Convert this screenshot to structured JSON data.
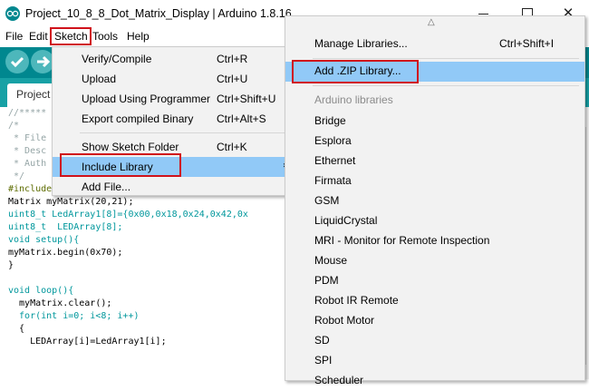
{
  "window": {
    "title": "Project_10_8_8_Dot_Matrix_Display | Arduino 1.8.16",
    "minimize_glyph": "",
    "maximize_glyph": "",
    "close_glyph": "✕"
  },
  "menubar": {
    "items": [
      {
        "label": "File"
      },
      {
        "label": "Edit"
      },
      {
        "label": "Sketch"
      },
      {
        "label": "Tools"
      },
      {
        "label": "Help"
      }
    ]
  },
  "toolbar": {
    "buttons": [
      "verify-icon",
      "upload-icon",
      "serial-monitor-icon"
    ],
    "color": "#00878f"
  },
  "tabs": [
    {
      "label": "Project"
    }
  ],
  "sketch_menu": {
    "items": [
      {
        "label": "Verify/Compile",
        "shortcut": "Ctrl+R"
      },
      {
        "label": "Upload",
        "shortcut": "Ctrl+U"
      },
      {
        "label": "Upload Using Programmer",
        "shortcut": "Ctrl+Shift+U"
      },
      {
        "label": "Export compiled Binary",
        "shortcut": "Ctrl+Alt+S"
      },
      {
        "label": "Show Sketch Folder",
        "shortcut": "Ctrl+K"
      },
      {
        "label": "Include Library",
        "shortcut": "",
        "submenu_arrow": "›",
        "highlighted": true
      },
      {
        "label": "Add File...",
        "shortcut": ""
      }
    ]
  },
  "library_menu": {
    "scroll_up_glyph": "△",
    "manage": {
      "label": "Manage Libraries...",
      "shortcut": "Ctrl+Shift+I"
    },
    "add_zip": {
      "label": "Add .ZIP Library...",
      "highlighted": true
    },
    "section_header": "Arduino libraries",
    "libraries": [
      "Bridge",
      "Esplora",
      "Ethernet",
      "Firmata",
      "GSM",
      "LiquidCrystal",
      "MRI - Monitor for Remote Inspection",
      "Mouse",
      "PDM",
      "Robot IR Remote",
      "Robot Motor",
      "SD",
      "SPI",
      "Scheduler"
    ]
  },
  "editor": {
    "lines": [
      "//*****",
      "/*",
      " * File",
      " * Desc",
      " * Auth",
      " */",
      "#include <Matrix.h>",
      "Matrix myMatrix(20,21);",
      "uint8_t LedArray1[8]={0x00,0x18,0x24,0x42,0x",
      "uint8_t  LEDArray[8];",
      "void setup(){",
      "myMatrix.begin(0x70);",
      "}",
      "",
      "void loop(){",
      "  myMatrix.clear();",
      "  for(int i=0; i<8; i++)",
      "  {",
      "    LEDArray[i]=LedArray1[i];"
    ]
  },
  "scrollbar": {
    "up_glyph": "^",
    "down_glyph": "v"
  }
}
